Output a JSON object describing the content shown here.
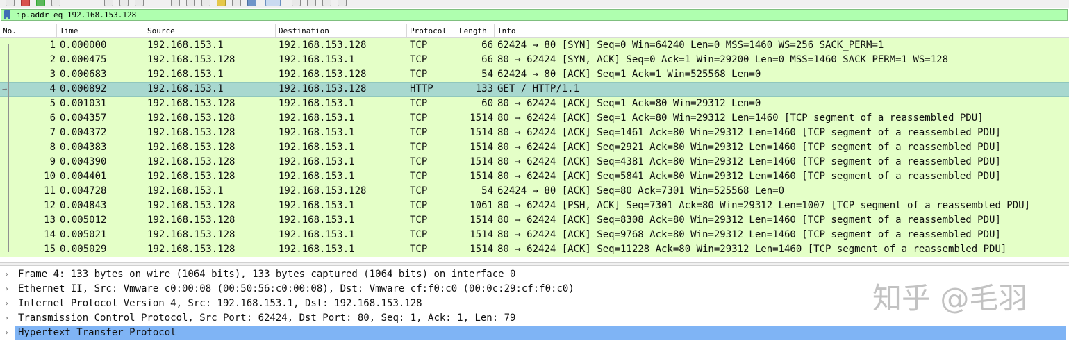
{
  "filter": {
    "value": "ip.addr eq 192.168.153.128"
  },
  "columns": {
    "no": "No.",
    "time": "Time",
    "source": "Source",
    "destination": "Destination",
    "protocol": "Protocol",
    "length": "Length",
    "info": "Info"
  },
  "packets": [
    {
      "no": "1",
      "time": "0.000000",
      "src": "192.168.153.1",
      "dst": "192.168.153.128",
      "proto": "TCP",
      "len": "66",
      "info": "62424 → 80 [SYN] Seq=0 Win=64240 Len=0 MSS=1460 WS=256 SACK_PERM=1"
    },
    {
      "no": "2",
      "time": "0.000475",
      "src": "192.168.153.128",
      "dst": "192.168.153.1",
      "proto": "TCP",
      "len": "66",
      "info": "80 → 62424 [SYN, ACK] Seq=0 Ack=1 Win=29200 Len=0 MSS=1460 SACK_PERM=1 WS=128"
    },
    {
      "no": "3",
      "time": "0.000683",
      "src": "192.168.153.1",
      "dst": "192.168.153.128",
      "proto": "TCP",
      "len": "54",
      "info": "62424 → 80 [ACK] Seq=1 Ack=1 Win=525568 Len=0"
    },
    {
      "no": "4",
      "time": "0.000892",
      "src": "192.168.153.1",
      "dst": "192.168.153.128",
      "proto": "HTTP",
      "len": "133",
      "info": "GET / HTTP/1.1",
      "selected": true
    },
    {
      "no": "5",
      "time": "0.001031",
      "src": "192.168.153.128",
      "dst": "192.168.153.1",
      "proto": "TCP",
      "len": "60",
      "info": "80 → 62424 [ACK] Seq=1 Ack=80 Win=29312 Len=0"
    },
    {
      "no": "6",
      "time": "0.004357",
      "src": "192.168.153.128",
      "dst": "192.168.153.1",
      "proto": "TCP",
      "len": "1514",
      "info": "80 → 62424 [ACK] Seq=1 Ack=80 Win=29312 Len=1460 [TCP segment of a reassembled PDU]"
    },
    {
      "no": "7",
      "time": "0.004372",
      "src": "192.168.153.128",
      "dst": "192.168.153.1",
      "proto": "TCP",
      "len": "1514",
      "info": "80 → 62424 [ACK] Seq=1461 Ack=80 Win=29312 Len=1460 [TCP segment of a reassembled PDU]"
    },
    {
      "no": "8",
      "time": "0.004383",
      "src": "192.168.153.128",
      "dst": "192.168.153.1",
      "proto": "TCP",
      "len": "1514",
      "info": "80 → 62424 [ACK] Seq=2921 Ack=80 Win=29312 Len=1460 [TCP segment of a reassembled PDU]"
    },
    {
      "no": "9",
      "time": "0.004390",
      "src": "192.168.153.128",
      "dst": "192.168.153.1",
      "proto": "TCP",
      "len": "1514",
      "info": "80 → 62424 [ACK] Seq=4381 Ack=80 Win=29312 Len=1460 [TCP segment of a reassembled PDU]"
    },
    {
      "no": "10",
      "time": "0.004401",
      "src": "192.168.153.128",
      "dst": "192.168.153.1",
      "proto": "TCP",
      "len": "1514",
      "info": "80 → 62424 [ACK] Seq=5841 Ack=80 Win=29312 Len=1460 [TCP segment of a reassembled PDU]"
    },
    {
      "no": "11",
      "time": "0.004728",
      "src": "192.168.153.1",
      "dst": "192.168.153.128",
      "proto": "TCP",
      "len": "54",
      "info": "62424 → 80 [ACK] Seq=80 Ack=7301 Win=525568 Len=0"
    },
    {
      "no": "12",
      "time": "0.004843",
      "src": "192.168.153.128",
      "dst": "192.168.153.1",
      "proto": "TCP",
      "len": "1061",
      "info": "80 → 62424 [PSH, ACK] Seq=7301 Ack=80 Win=29312 Len=1007 [TCP segment of a reassembled PDU]"
    },
    {
      "no": "13",
      "time": "0.005012",
      "src": "192.168.153.128",
      "dst": "192.168.153.1",
      "proto": "TCP",
      "len": "1514",
      "info": "80 → 62424 [ACK] Seq=8308 Ack=80 Win=29312 Len=1460 [TCP segment of a reassembled PDU]"
    },
    {
      "no": "14",
      "time": "0.005021",
      "src": "192.168.153.128",
      "dst": "192.168.153.1",
      "proto": "TCP",
      "len": "1514",
      "info": "80 → 62424 [ACK] Seq=9768 Ack=80 Win=29312 Len=1460 [TCP segment of a reassembled PDU]"
    },
    {
      "no": "15",
      "time": "0.005029",
      "src": "192.168.153.128",
      "dst": "192.168.153.1",
      "proto": "TCP",
      "len": "1514",
      "info": "80 → 62424 [ACK] Seq=11228 Ack=80 Win=29312 Len=1460 [TCP segment of a reassembled PDU]"
    }
  ],
  "details": [
    {
      "text": "Frame 4: 133 bytes on wire (1064 bits), 133 bytes captured (1064 bits) on interface 0"
    },
    {
      "text": "Ethernet II, Src: Vmware_c0:00:08 (00:50:56:c0:00:08), Dst: Vmware_cf:f0:c0 (00:0c:29:cf:f0:c0)"
    },
    {
      "text": "Internet Protocol Version 4, Src: 192.168.153.1, Dst: 192.168.153.128"
    },
    {
      "text": "Transmission Control Protocol, Src Port: 62424, Dst Port: 80, Seq: 1, Ack: 1, Len: 79"
    },
    {
      "text": "Hypertext Transfer Protocol",
      "selected": true
    }
  ],
  "watermark": "知乎 @毛羽",
  "colors": {
    "filter_valid": "#afffaf",
    "tcp_row": "#e4ffc7",
    "selected_row": "#a8d8cf",
    "selected_detail": "#7fb4f5"
  },
  "icons": {
    "bookmark": "bookmark-icon",
    "expand": "chevron-right-icon"
  }
}
